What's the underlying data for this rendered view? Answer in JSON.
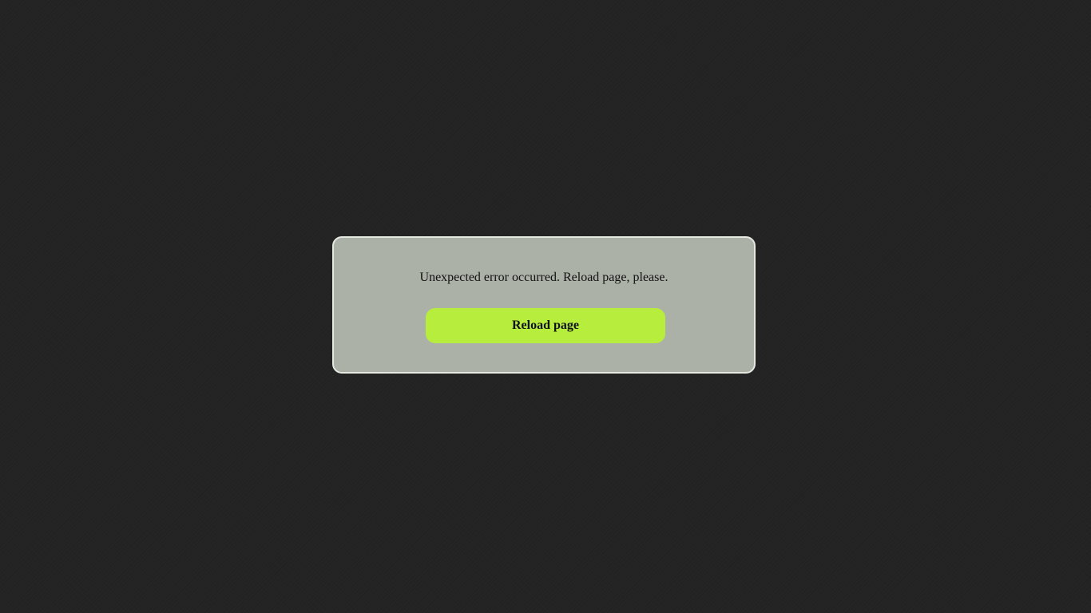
{
  "dialog": {
    "message": "Unexpected error occurred. Reload page, please.",
    "reload_label": "Reload page"
  },
  "colors": {
    "background": "#232323",
    "dialog_background": "#abb1a7",
    "dialog_border": "#e6e8e2",
    "button_background": "#b7ee3e",
    "text": "#111111"
  }
}
